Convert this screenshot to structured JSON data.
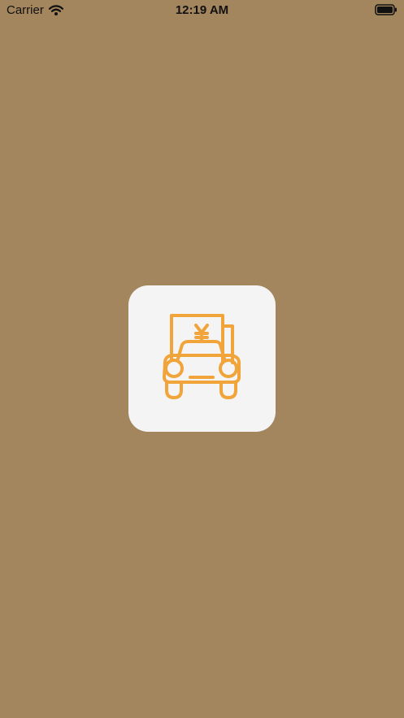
{
  "status_bar": {
    "carrier": "Carrier",
    "time": "12:19 AM",
    "wifi_icon": "wifi-icon",
    "battery_icon": "battery-icon"
  },
  "splash": {
    "icon": "car-with-yen-sign-icon",
    "accent_color": "#f0a43a",
    "background_color": "#a3855e",
    "card_color": "#f4f4f4"
  }
}
